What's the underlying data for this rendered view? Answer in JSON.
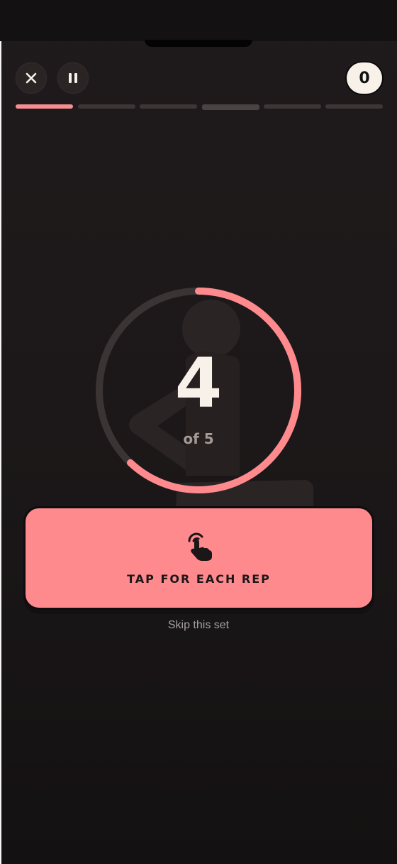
{
  "header": {
    "close_icon": "close-icon",
    "pause_icon": "pause-icon",
    "score": "0"
  },
  "progress": {
    "total_segments": 6,
    "completed_segments": 1,
    "current_segment": 4
  },
  "exercise": {
    "rep_count": "4",
    "of_label": "of 5",
    "ring_progress": 0.62
  },
  "actions": {
    "tap_icon": "tap-hand-icon",
    "tap_label": "TAP FOR EACH REP",
    "skip_label": "Skip this set"
  },
  "colors": {
    "accent": "#ff8a8e",
    "background": "#1c1819",
    "ring_track": "#3a3435",
    "text_light": "#f8f1e9"
  }
}
